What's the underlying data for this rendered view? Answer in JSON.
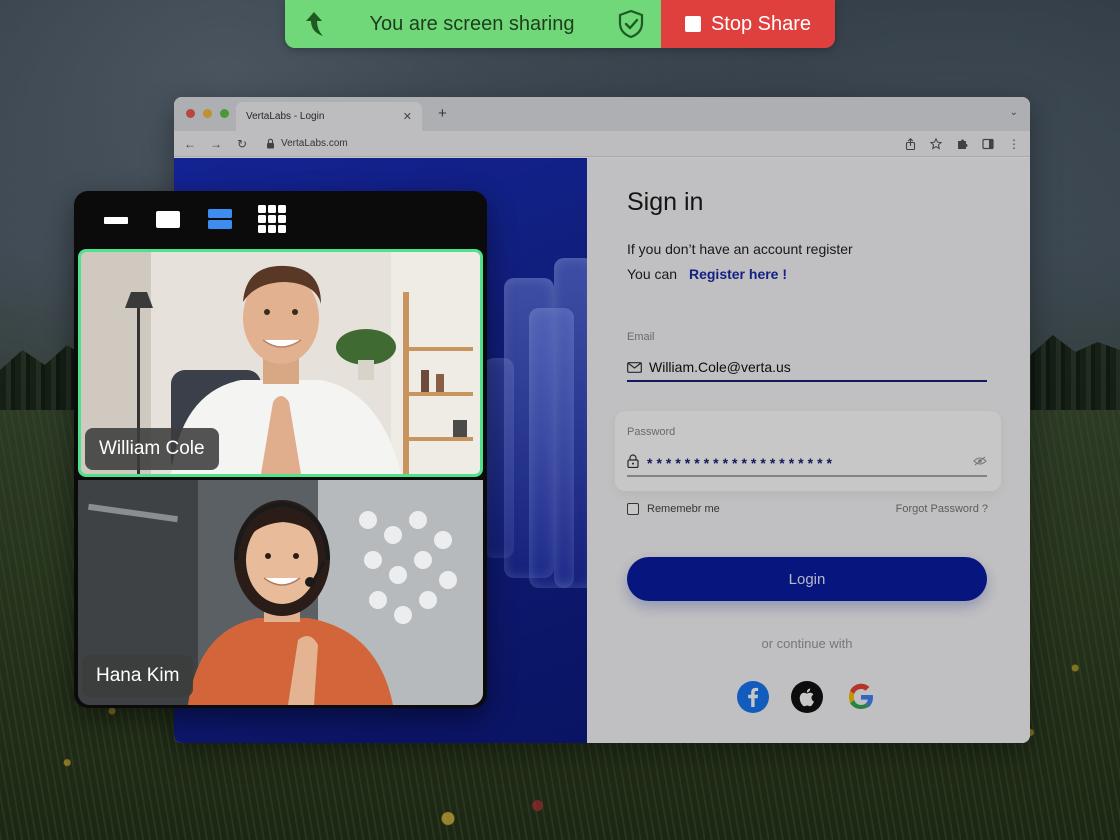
{
  "share_bar": {
    "status_text": "You are screen sharing",
    "stop_label": "Stop Share",
    "colors": {
      "status_bg": "#71d87a",
      "stop_bg": "#e0403d"
    }
  },
  "browser": {
    "tab_title": "VertaLabs - Login",
    "tab_close": "✕",
    "new_tab": "+",
    "tab_menu": "⌄",
    "url": "VertaLabs.com"
  },
  "signin": {
    "title": "Sign in",
    "register_line1": "If you don’t have an account register",
    "register_line2_prefix": "You can",
    "register_link": "Register here !",
    "email_label": "Email",
    "email_value": "William.Cole@verta.us",
    "password_label": "Password",
    "password_value": "********************",
    "remember_label": "Rememebr me",
    "forgot_label": "Forgot Password ?",
    "login_label": "Login",
    "continue_label": "or continue with",
    "social_icons": [
      "facebook-icon",
      "apple-icon",
      "google-icon"
    ],
    "colors": {
      "primary": "#0a1ba3",
      "link": "#1b2aa8"
    }
  },
  "video": {
    "layout_icons": [
      "single-bar-icon",
      "single-tile-icon",
      "stacked-tiles-icon",
      "grid-icon"
    ],
    "participants": [
      {
        "name": "William Cole",
        "active": true
      },
      {
        "name": "Hana Kim",
        "active": false
      }
    ],
    "colors": {
      "active_border": "#4ee28c",
      "selected_layout": "#3d8cf0"
    }
  }
}
